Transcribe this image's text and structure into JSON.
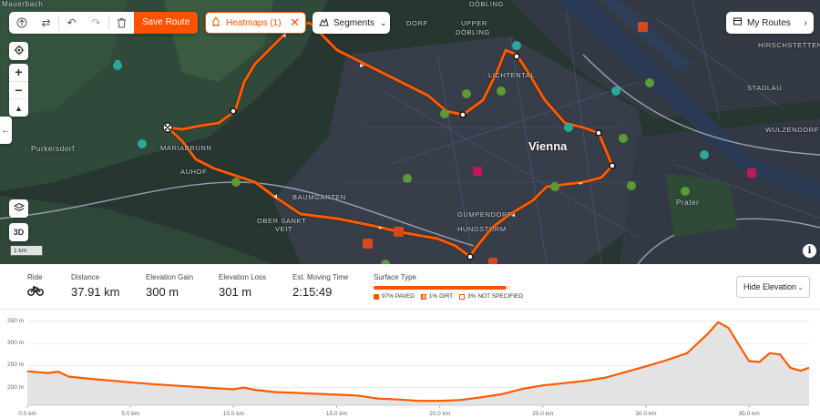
{
  "toolbar": {
    "save_label": "Save Route",
    "icons": [
      "upload-icon",
      "swap-icon",
      "undo-icon",
      "redo-icon",
      "trash-icon"
    ]
  },
  "heatmaps": {
    "label": "Heatmaps (1)"
  },
  "segments": {
    "label": "Segments"
  },
  "my_routes": {
    "label": "My Routes"
  },
  "map": {
    "scale_label": "1 km",
    "labels": [
      {
        "text": "Mauerbach"
      },
      {
        "text": "Purkersdorf"
      },
      {
        "text": "MARIABRUNN"
      },
      {
        "text": "AUHOF"
      },
      {
        "text": "BAUMGARTEN"
      },
      {
        "text": "OBER SANKT"
      },
      {
        "text": "VEIT"
      },
      {
        "text": "UPPER"
      },
      {
        "text": "DÖBLING"
      },
      {
        "text": "DORF"
      },
      {
        "text": "LICHTENTAL"
      },
      {
        "text": "Vienna"
      },
      {
        "text": "GUMPENDORF"
      },
      {
        "text": "HUNDSTURM"
      },
      {
        "text": "HIRSCHSTETTEN"
      },
      {
        "text": "STADLAU"
      },
      {
        "text": "WULZENDORF"
      },
      {
        "text": "Prater"
      },
      {
        "text": "DÖBLING"
      }
    ]
  },
  "stats": {
    "ride_label": "Ride",
    "distance": {
      "label": "Distance",
      "value": "37.91 km"
    },
    "gain": {
      "label": "Elevation Gain",
      "value": "300 m"
    },
    "loss": {
      "label": "Elevation Loss",
      "value": "301 m"
    },
    "time": {
      "label": "Est. Moving Time",
      "value": "2:15:49"
    },
    "surface": {
      "label": "Surface Type",
      "paved_pct": 97,
      "dirt_pct": 1,
      "unknown_pct": 3,
      "paved_label": "97% PAVED",
      "dirt_label": "1% DIRT",
      "unknown_label": "3% NOT SPECIFIED"
    }
  },
  "hide_elevation": {
    "label": "Hide Elevation"
  },
  "colors": {
    "accent": "#fc5200",
    "route": "#ff5a00"
  },
  "chart_data": {
    "type": "area",
    "xlabel": "",
    "ylabel": "",
    "x_ticks": [
      "0.0 km",
      "5.0 km",
      "10.0 km",
      "15.0 km",
      "20.0 km",
      "25.0 km",
      "30.0 km",
      "35.0 km"
    ],
    "y_ticks": [
      "350 m",
      "300 m",
      "250 m",
      "200 m"
    ],
    "xlim": [
      0,
      37.91
    ],
    "ylim": [
      160,
      360
    ],
    "x": [
      0,
      1,
      1.5,
      2,
      3,
      4,
      5,
      6,
      7,
      8,
      9,
      10,
      10.5,
      11,
      12,
      13,
      14,
      15,
      16,
      17,
      18,
      19,
      20,
      21,
      22,
      23,
      24,
      25,
      26,
      27,
      28,
      29,
      30,
      31,
      32,
      32.5,
      33,
      33.5,
      34,
      35,
      35.5,
      36,
      36.5,
      37,
      37.5,
      37.91
    ],
    "y": [
      237,
      233,
      236,
      225,
      220,
      216,
      212,
      208,
      205,
      202,
      199,
      196,
      200,
      195,
      190,
      188,
      186,
      184,
      182,
      175,
      173,
      170,
      170,
      172,
      178,
      185,
      197,
      205,
      210,
      215,
      222,
      235,
      248,
      262,
      278,
      300,
      322,
      348,
      335,
      260,
      258,
      278,
      275,
      245,
      238,
      245
    ],
    "grid": true
  }
}
